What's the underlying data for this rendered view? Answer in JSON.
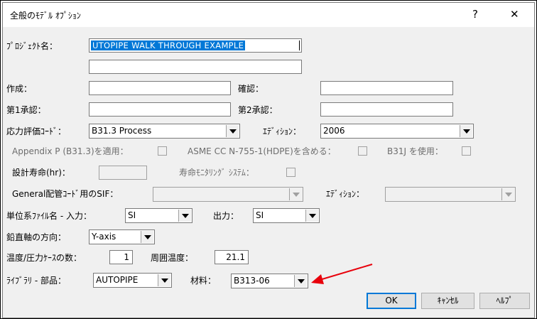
{
  "title": "全般のﾓﾃﾞﾙ ｵﾌﾟｼｮﾝ",
  "titlebar": {
    "help": "?",
    "close": "✕"
  },
  "fields": {
    "project_label": "ﾌﾟﾛｼﾞｪｸﾄ名：",
    "project_value": "UTOPIPE  WALK  THROUGH  EXAMPLE",
    "project_line2": "",
    "author_label": "作成：",
    "author_value": "",
    "check_label": "確認：",
    "check_value": "",
    "approve1_label": "第1承認：",
    "approve1_value": "",
    "approve2_label": "第2承認：",
    "approve2_value": "",
    "code_label": "応力評価ｺｰﾄﾞ：",
    "code_value": "B31.3 Process",
    "edition_label": "ｴﾃﾞｨｼｮﾝ：",
    "edition_value": "2006",
    "appendix_label": "Appendix P (B31.3)を適用：",
    "asme_label": "ASME CC N-755-1(HDPE)を含める：",
    "b31j_label": "B31J を使用：",
    "life_label": "設計寿命(hr)：",
    "life_value": "",
    "monitor_label": "寿命ﾓﾆﾀﾘﾝｸﾞ ｼｽﾃﾑ：",
    "sif_label": "General配管ｺｰﾄﾞ用のSIF：",
    "sif_value": "",
    "sif_edition_label": "ｴﾃﾞｨｼｮﾝ：",
    "sif_edition_value": "",
    "units_in_label": "単位系ﾌｧｲﾙ名 - 入力：",
    "units_in_value": "SI",
    "units_out_label": "出力：",
    "units_out_value": "SI",
    "vertical_label": "鉛直軸の方向：",
    "vertical_value": "Y-axis",
    "cases_label": "温度/圧力ｹｰｽの数：",
    "cases_value": "1",
    "ambient_label": "周囲温度：",
    "ambient_value": "21.1",
    "library_label": "ﾗｲﾌﾞﾗﾘ - 部品：",
    "library_value": "AUTOPIPE",
    "material_label": "材料：",
    "material_value": "B313-06"
  },
  "buttons": {
    "ok": "OK",
    "cancel": "ｷｬﾝｾﾙ",
    "help": "ﾍﾙﾌﾟ"
  },
  "colors": {
    "accent": "#0078d7",
    "annotation_arrow": "#e8000b"
  }
}
